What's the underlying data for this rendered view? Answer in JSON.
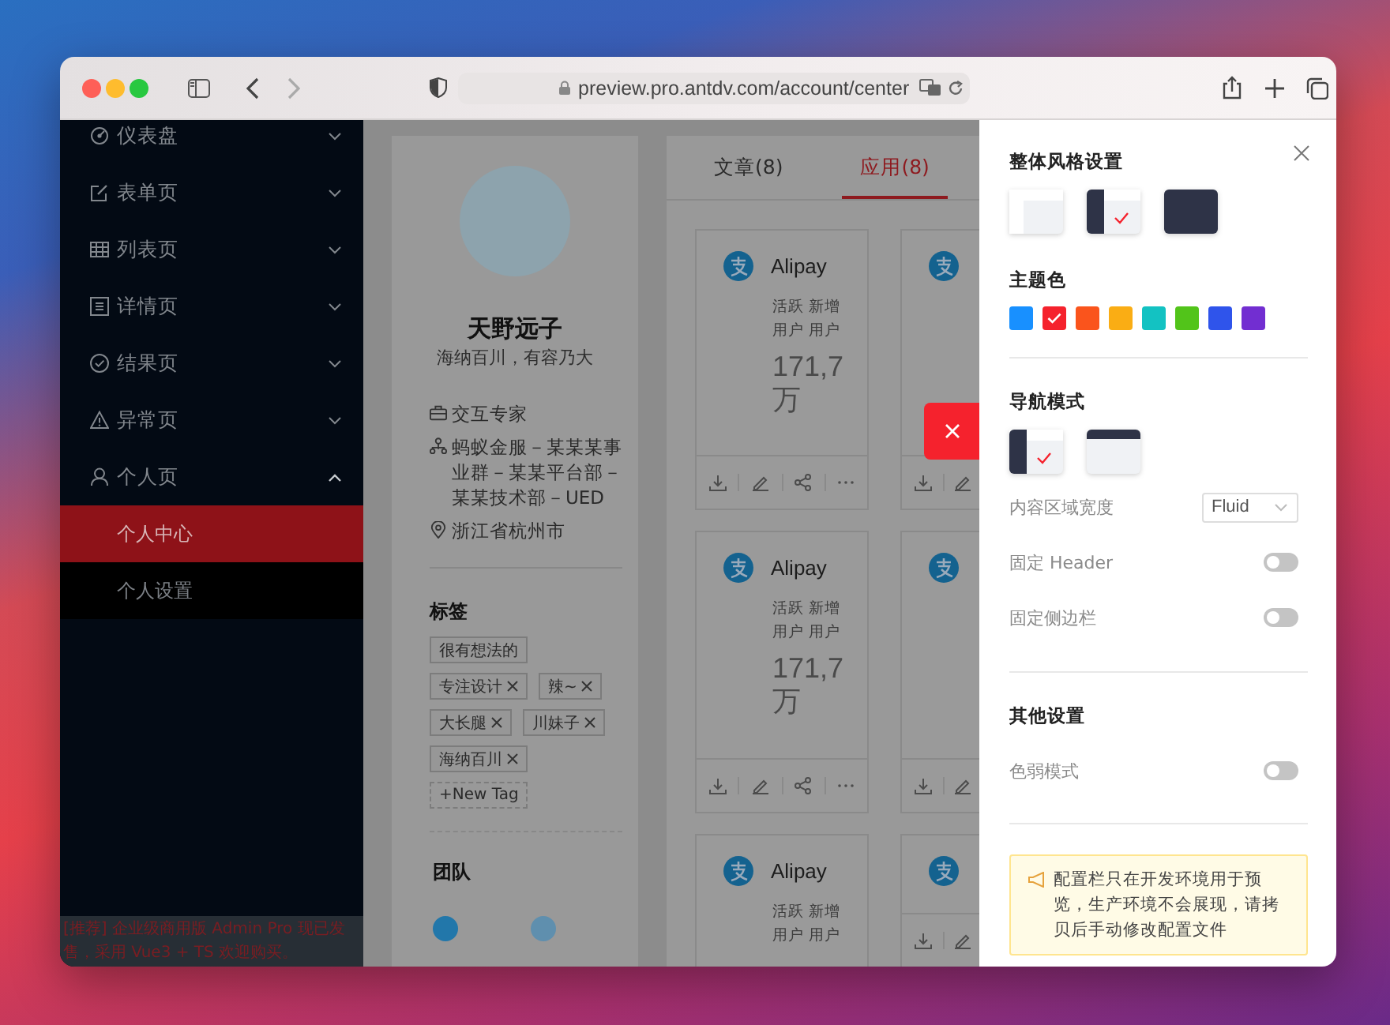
{
  "browser": {
    "url": "preview.pro.antdv.com/account/center"
  },
  "sidebar": {
    "menu": [
      {
        "label": "仪表盘",
        "expanded": false
      },
      {
        "label": "表单页",
        "expanded": false
      },
      {
        "label": "列表页",
        "expanded": false
      },
      {
        "label": "详情页",
        "expanded": false
      },
      {
        "label": "结果页",
        "expanded": false
      },
      {
        "label": "异常页",
        "expanded": false
      },
      {
        "label": "个人页",
        "expanded": true,
        "children": [
          {
            "label": "个人中心",
            "selected": true
          },
          {
            "label": "个人设置",
            "selected": false
          }
        ]
      }
    ],
    "promo": "[推荐] 企业级商用版 Admin Pro 现已发售，采用 Vue3 + TS 欢迎购买。"
  },
  "profile": {
    "name": "天野远子",
    "motto": "海纳百川，有容乃大",
    "info": [
      {
        "text": "交互专家"
      },
      {
        "text": "蚂蚁金服－某某某事业群－某某平台部－某某技术部－UED"
      },
      {
        "text": "浙江省杭州市"
      }
    ],
    "tags_title": "标签",
    "tags": [
      {
        "label": "很有想法的",
        "closable": false
      },
      {
        "label": "专注设计",
        "closable": true
      },
      {
        "label": "辣~",
        "closable": true
      },
      {
        "label": "大长腿",
        "closable": true
      },
      {
        "label": "川妹子",
        "closable": true
      },
      {
        "label": "海纳百川",
        "closable": true
      }
    ],
    "new_tag": "+New Tag",
    "team_title": "团队"
  },
  "tabs": [
    {
      "label": "文章(8)",
      "selected": false
    },
    {
      "label": "应用(8)",
      "selected": true
    }
  ],
  "apps": [
    {
      "kind": "full",
      "name": "Alipay",
      "stat_lines": [
        "活跃 新增",
        "用户 用户"
      ],
      "value_lines": [
        "171,7",
        "万"
      ]
    },
    {
      "kind": "clipped"
    },
    {
      "kind": "full",
      "name": "Alipay",
      "stat_lines": [
        "活跃 新增",
        "用户 用户"
      ],
      "value_lines": [
        "171,7",
        "万"
      ]
    },
    {
      "kind": "clipped"
    },
    {
      "kind": "partial",
      "name": "Alipay",
      "stat_lines": [
        "活跃 新增",
        "用户 用户"
      ]
    },
    {
      "kind": "clipped"
    }
  ],
  "drawer": {
    "style_title": "整体风格设置",
    "styles": [
      {
        "kind": "light",
        "selected": false
      },
      {
        "kind": "dark-side",
        "selected": true
      },
      {
        "kind": "dark",
        "selected": false
      }
    ],
    "theme_title": "主题色",
    "theme_colors": [
      {
        "color": "#1890ff",
        "selected": false
      },
      {
        "color": "#f5222d",
        "selected": true
      },
      {
        "color": "#fa541c",
        "selected": false
      },
      {
        "color": "#faad14",
        "selected": false
      },
      {
        "color": "#13c2c2",
        "selected": false
      },
      {
        "color": "#52c41a",
        "selected": false
      },
      {
        "color": "#2f54eb",
        "selected": false
      },
      {
        "color": "#722ed1",
        "selected": false
      }
    ],
    "nav_title": "导航模式",
    "nav_modes": [
      {
        "kind": "side",
        "selected": true
      },
      {
        "kind": "top",
        "selected": false
      }
    ],
    "content_width": {
      "label": "内容区域宽度",
      "value": "Fluid"
    },
    "switches": [
      {
        "label": "固定 Header",
        "on": false
      },
      {
        "label": "固定侧边栏",
        "on": false
      }
    ],
    "other_title": "其他设置",
    "other_switches": [
      {
        "label": "色弱模式",
        "on": false
      }
    ],
    "notice": "配置栏只在开发环境用于预览，生产环境不会展现，请拷贝后手动修改配置文件"
  }
}
